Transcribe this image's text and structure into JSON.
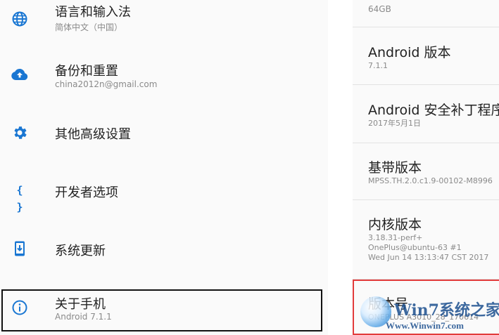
{
  "settings": {
    "items": [
      {
        "title": "语言和输入法",
        "subtitle": "简体中文（中国）",
        "icon": "globe-icon"
      },
      {
        "title": "备份和重置",
        "subtitle": "china2012n@gmail.com",
        "icon": "cloud-upload-icon"
      },
      {
        "title": "其他高级设置",
        "subtitle": "",
        "icon": "gear-icon"
      },
      {
        "title": "开发者选项",
        "subtitle": "",
        "icon": "braces-icon",
        "glyph": "{ }"
      },
      {
        "title": "系统更新",
        "subtitle": "",
        "icon": "system-update-icon"
      },
      {
        "title": "关于手机",
        "subtitle": "Android 7.1.1",
        "icon": "info-icon"
      }
    ],
    "accent_color": "#1976d2"
  },
  "about": {
    "storage_value": "64GB",
    "items": [
      {
        "title": "Android 版本",
        "value": "7.1.1"
      },
      {
        "title": "Android 安全补丁程序",
        "value": "2017年5月1日"
      },
      {
        "title": "基带版本",
        "value": "MPSS.TH.2.0.c1.9-00102-M8996"
      },
      {
        "title": "内核版本",
        "value_lines": [
          "3.18.31-perf+",
          "OnePlus@ubuntu-63 #1",
          "Wed Jun 14 13:13:47 CST 2017"
        ]
      },
      {
        "title": "版本号",
        "value": "ONEPLUS A3010_28_170614"
      }
    ]
  },
  "watermark": {
    "text": "Win7系统之家",
    "url": "Www.Winwin7.com"
  },
  "colors": {
    "highlight_black": "#111111",
    "highlight_red": "#e23b3b"
  }
}
